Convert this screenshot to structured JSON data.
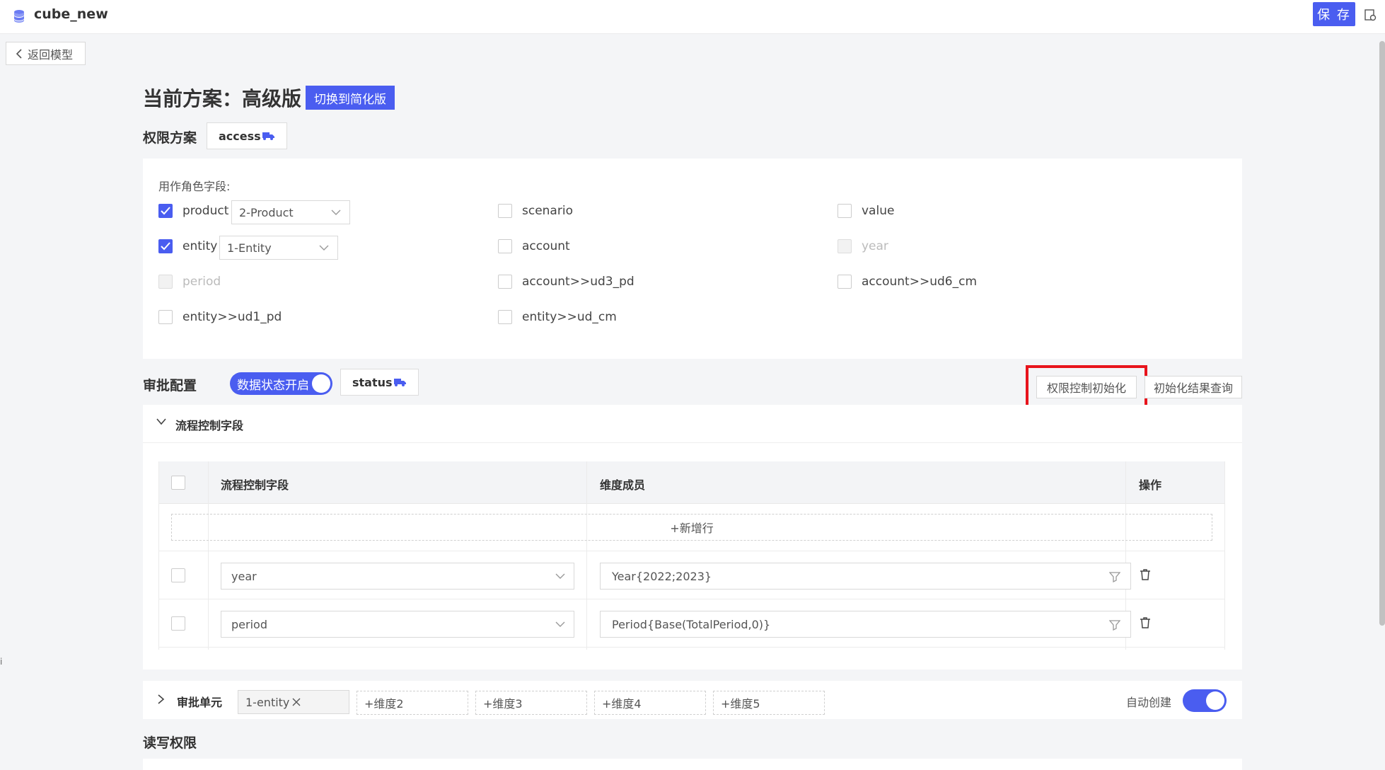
{
  "topbar": {
    "title": "cube_new",
    "save_label": "保 存"
  },
  "back": {
    "label": "返回模型"
  },
  "plan": {
    "title": "当前方案：高级版",
    "switch_label": "切换到简化版"
  },
  "permission": {
    "label": "权限方案",
    "tag": "access"
  },
  "roles": {
    "label": "用作角色字段:",
    "items": [
      {
        "label": "product",
        "checked": true,
        "disabled": false,
        "select": "2-Product"
      },
      {
        "label": "entity",
        "checked": true,
        "disabled": false,
        "select": "1-Entity"
      },
      {
        "label": "period",
        "checked": false,
        "disabled": true
      },
      {
        "label": "entity>>ud1_pd",
        "checked": false,
        "disabled": false
      },
      {
        "label": "scenario",
        "checked": false,
        "disabled": false
      },
      {
        "label": "account",
        "checked": false,
        "disabled": false
      },
      {
        "label": "account>>ud3_pd",
        "checked": false,
        "disabled": false
      },
      {
        "label": "entity>>ud_cm",
        "checked": false,
        "disabled": false
      },
      {
        "label": "value",
        "checked": false,
        "disabled": false
      },
      {
        "label": "year",
        "checked": false,
        "disabled": true
      },
      {
        "label": "account>>ud6_cm",
        "checked": false,
        "disabled": false
      }
    ]
  },
  "approval": {
    "label": "审批配置",
    "toggle_label": "数据状态开启",
    "tag": "status",
    "init_button": "权限控制初始化",
    "query_button": "初始化结果查询"
  },
  "flow": {
    "section_title": "流程控制字段",
    "columns": [
      "流程控制字段",
      "维度成员",
      "操作"
    ],
    "add_row": "+新增行",
    "rows": [
      {
        "field": "year",
        "members": "Year{2022;2023}"
      },
      {
        "field": "period",
        "members": "Period{Base(TotalPeriod,0)}"
      }
    ]
  },
  "unit": {
    "label": "审批单元",
    "chips": [
      "1-entity",
      "+维度2",
      "+维度3",
      "+维度4",
      "+维度5"
    ],
    "auto_create": "自动创建"
  },
  "rw": {
    "label": "读写权限"
  }
}
